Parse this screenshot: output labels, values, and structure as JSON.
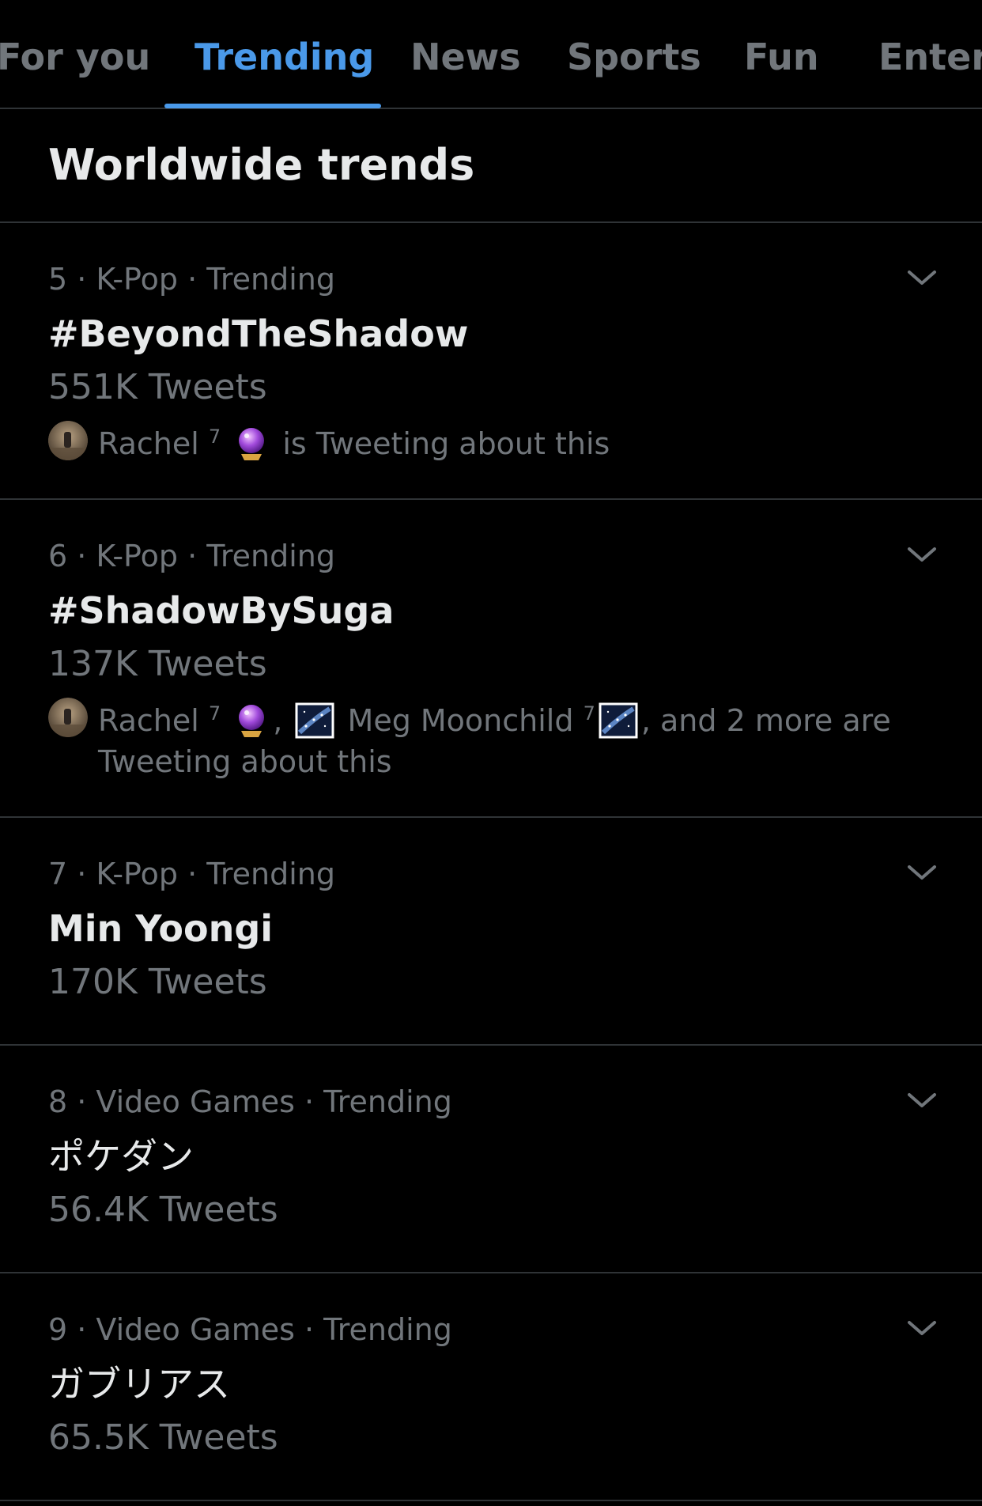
{
  "tabs": [
    {
      "label": "For you",
      "active": false
    },
    {
      "label": "Trending",
      "active": true
    },
    {
      "label": "News",
      "active": false
    },
    {
      "label": "Sports",
      "active": false
    },
    {
      "label": "Fun",
      "active": false
    },
    {
      "label": "Entert",
      "active": false
    }
  ],
  "section_title": "Worldwide trends",
  "colors": {
    "accent": "#4a99e9",
    "background": "#000000",
    "primary_text": "#e7e9ea",
    "secondary_text": "#71767b",
    "divider": "#2f3336"
  },
  "trends": [
    {
      "meta": "5 · K-Pop · Trending",
      "name": "#BeyondTheShadow",
      "count": "551K Tweets",
      "social": {
        "name_1": "Rachel",
        "sup_1": "7",
        "tail": "is Tweeting about this"
      }
    },
    {
      "meta": "6 · K-Pop · Trending",
      "name": "#ShadowBySuga",
      "count": "137K Tweets",
      "social": {
        "name_1": "Rachel",
        "sup_1": "7",
        "sep": ",",
        "name_2": "Meg Moonchild",
        "sup_2": "7",
        "tail": ", and 2 more are Tweeting about this"
      }
    },
    {
      "meta": "7 · K-Pop · Trending",
      "name": "Min Yoongi",
      "count": "170K Tweets"
    },
    {
      "meta": "8 · Video Games · Trending",
      "name": "ポケダン",
      "count": "56.4K Tweets"
    },
    {
      "meta": "9 · Video Games · Trending",
      "name": "ガブリアス",
      "count": "65.5K Tweets"
    }
  ],
  "icons": {
    "chevron": "chevron-down-icon",
    "crystal_ball": "crystal-ball-emoji",
    "milky_way": "milky-way-emoji",
    "avatar": "avatar"
  }
}
